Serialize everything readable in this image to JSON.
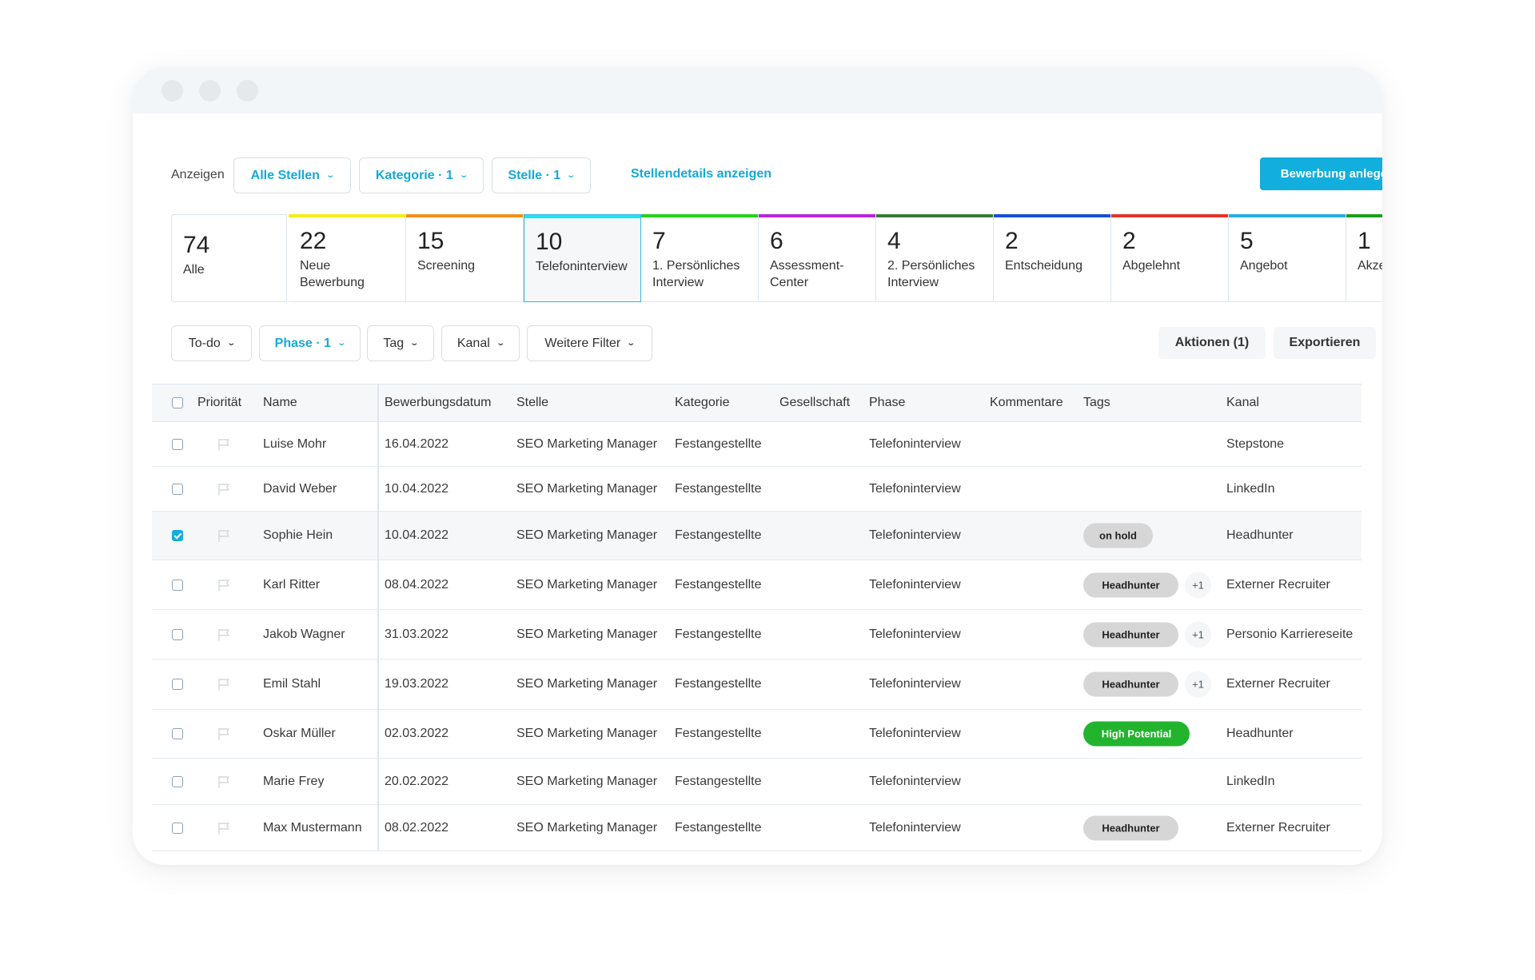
{
  "window": {
    "controls": [
      "close",
      "minimize",
      "maximize"
    ]
  },
  "toolbar": {
    "show_label": "Anzeigen",
    "dropdowns": [
      {
        "label": "Alle Stellen",
        "icon": "chevron-down-icon"
      },
      {
        "label": "Kategorie · 1",
        "icon": "chevron-down-icon"
      },
      {
        "label": "Stelle · 1",
        "icon": "chevron-down-icon"
      }
    ],
    "details_link": "Stellendetails anzeigen",
    "create_button": "Bewerbung anlegen"
  },
  "stages": [
    {
      "count": "74",
      "label": "Alle",
      "color": ""
    },
    {
      "count": "22",
      "label": "Neue Bewerbung",
      "color": "#f2ee1a"
    },
    {
      "count": "15",
      "label": "Screening",
      "color": "#f39019"
    },
    {
      "count": "10",
      "label": "Telefoninterview",
      "color": "#16e8f5",
      "selected": true
    },
    {
      "count": "7",
      "label": "1. Persönliches Interview",
      "color": "#22d31e"
    },
    {
      "count": "6",
      "label": "Assessment-Center",
      "color": "#b823e0"
    },
    {
      "count": "4",
      "label": "2. Persönliches Interview",
      "color": "#3b7a35"
    },
    {
      "count": "2",
      "label": "Entscheidung",
      "color": "#1550d6"
    },
    {
      "count": "2",
      "label": "Abgelehnt",
      "color": "#e5332a"
    },
    {
      "count": "5",
      "label": "Angebot",
      "color": "#22aee0"
    },
    {
      "count": "1",
      "label": "Akzeptiert",
      "color": "#1a9f1a"
    }
  ],
  "filters": {
    "dropdowns": [
      {
        "label": "To-do",
        "active": false
      },
      {
        "label": "Phase · 1",
        "active": true
      },
      {
        "label": "Tag",
        "active": false
      },
      {
        "label": "Kanal",
        "active": false
      },
      {
        "label": "Weitere Filter",
        "active": false
      }
    ],
    "actions_button": "Aktionen (1)",
    "export_button": "Exportieren"
  },
  "table": {
    "columns": [
      "Priorität",
      "Name",
      "Bewerbungsdatum",
      "Stelle",
      "Kategorie",
      "Gesellschaft",
      "Phase",
      "Kommentare",
      "Tags",
      "Kanal"
    ],
    "rows": [
      {
        "checked": false,
        "name": "Luise Mohr",
        "date": "16.04.2022",
        "position": "SEO Marketing Manager",
        "category": "Festangestellte",
        "company": "",
        "phase": "Telefoninterview",
        "comments": "",
        "tags": [],
        "extra_tags": "",
        "channel": "Stepstone"
      },
      {
        "checked": false,
        "name": "David Weber",
        "date": "10.04.2022",
        "position": "SEO Marketing Manager",
        "category": "Festangestellte",
        "company": "",
        "phase": "Telefoninterview",
        "comments": "",
        "tags": [],
        "extra_tags": "",
        "channel": "LinkedIn"
      },
      {
        "checked": true,
        "name": "Sophie Hein",
        "date": "10.04.2022",
        "position": "SEO Marketing Manager",
        "category": "Festangestellte",
        "company": "",
        "phase": "Telefoninterview",
        "comments": "",
        "tags": [
          {
            "label": "on hold",
            "color": "grey"
          }
        ],
        "extra_tags": "",
        "channel": "Headhunter"
      },
      {
        "checked": false,
        "name": "Karl Ritter",
        "date": "08.04.2022",
        "position": "SEO Marketing Manager",
        "category": "Festangestellte",
        "company": "",
        "phase": "Telefoninterview",
        "comments": "",
        "tags": [
          {
            "label": "Headhunter",
            "color": "grey"
          }
        ],
        "extra_tags": "+1",
        "channel": "Externer Recruiter"
      },
      {
        "checked": false,
        "name": "Jakob Wagner",
        "date": "31.03.2022",
        "position": "SEO Marketing Manager",
        "category": "Festangestellte",
        "company": "",
        "phase": "Telefoninterview",
        "comments": "",
        "tags": [
          {
            "label": "Headhunter",
            "color": "grey"
          }
        ],
        "extra_tags": "+1",
        "channel": "Personio Karriereseite"
      },
      {
        "checked": false,
        "name": "Emil Stahl",
        "date": "19.03.2022",
        "position": "SEO Marketing Manager",
        "category": "Festangestellte",
        "company": "",
        "phase": "Telefoninterview",
        "comments": "",
        "tags": [
          {
            "label": "Headhunter",
            "color": "grey"
          }
        ],
        "extra_tags": "+1",
        "channel": "Externer Recruiter"
      },
      {
        "checked": false,
        "name": "Oskar Müller",
        "date": "02.03.2022",
        "position": "SEO Marketing Manager",
        "category": "Festangestellte",
        "company": "",
        "phase": "Telefoninterview",
        "comments": "",
        "tags": [
          {
            "label": "High Potential",
            "color": "green"
          }
        ],
        "extra_tags": "",
        "channel": "Headhunter"
      },
      {
        "checked": false,
        "name": "Marie Frey",
        "date": "20.02.2022",
        "position": "SEO Marketing Manager",
        "category": "Festangestellte",
        "company": "",
        "phase": "Telefoninterview",
        "comments": "",
        "tags": [],
        "extra_tags": "",
        "channel": "LinkedIn"
      },
      {
        "checked": false,
        "name": "Max Mustermann",
        "date": "08.02.2022",
        "position": "SEO Marketing Manager",
        "category": "Festangestellte",
        "company": "",
        "phase": "Telefoninterview",
        "comments": "",
        "tags": [
          {
            "label": "Headhunter",
            "color": "grey"
          }
        ],
        "extra_tags": "",
        "channel": "Externer Recruiter"
      }
    ]
  }
}
